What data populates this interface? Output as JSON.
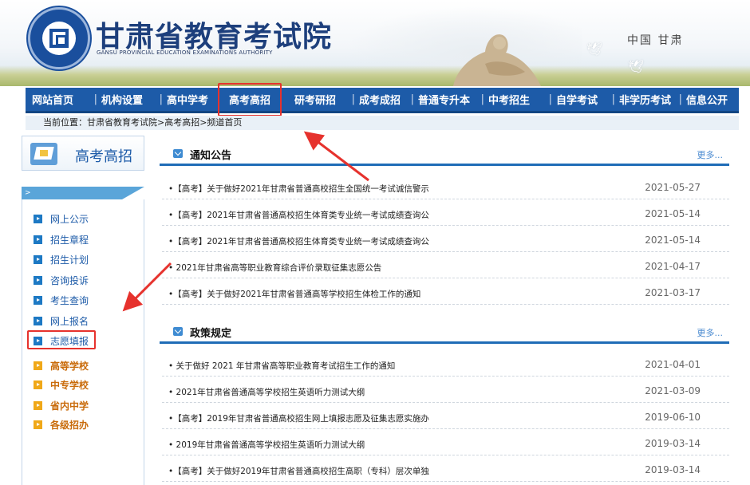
{
  "header": {
    "title": "甘肃省教育考试院",
    "subtitle": "GANSU PROVINCIAL EDUCATION EXAMINATIONS AUTHORITY",
    "region": "中国 甘肃"
  },
  "nav": {
    "items": [
      "网站首页",
      "机构设置",
      "高中学考",
      "高考高招",
      "研考研招",
      "成考成招",
      "普通专升本",
      "中考招生",
      "自学考试",
      "非学历考试",
      "信息公开"
    ]
  },
  "breadcrumb": "当前位置：甘肃省教育考试院>高考高招>频道首页",
  "sidebar": {
    "title": "高考高招",
    "bar_marker": ">",
    "items": [
      "网上公示",
      "招生章程",
      "招生计划",
      "咨询投诉",
      "考生查询",
      "网上报名",
      "志愿填报"
    ],
    "links": [
      "高等学校",
      "中专学校",
      "省内中学",
      "各级招办"
    ]
  },
  "sections": {
    "notices": {
      "title": "通知公告",
      "more": "更多...",
      "items": [
        {
          "title": "•【高考】关于做好2021年甘肃省普通高校招生全国统一考试诚信警示",
          "date": "2021-05-27"
        },
        {
          "title": "•【高考】2021年甘肃省普通高校招生体育类专业统一考试成绩查询公",
          "date": "2021-05-14"
        },
        {
          "title": "•【高考】2021年甘肃省普通高校招生体育类专业统一考试成绩查询公",
          "date": "2021-05-14"
        },
        {
          "title": "• 2021年甘肃省高等职业教育综合评价录取征集志愿公告",
          "date": "2021-04-17"
        },
        {
          "title": "•【高考】关于做好2021年甘肃省普通高等学校招生体检工作的通知",
          "date": "2021-03-17"
        }
      ]
    },
    "policy": {
      "title": "政策规定",
      "more": "更多...",
      "items": [
        {
          "title": "• 关于做好  2021  年甘肃省高等职业教育考试招生工作的通知",
          "date": "2021-04-01"
        },
        {
          "title": "• 2021年甘肃省普通高等学校招生英语听力测试大纲",
          "date": "2021-03-09"
        },
        {
          "title": "•【高考】2019年甘肃省普通高校招生网上填报志愿及征集志愿实施办",
          "date": "2019-06-10"
        },
        {
          "title": "• 2019年甘肃省普通高等学校招生英语听力测试大纲",
          "date": "2019-03-14"
        },
        {
          "title": "•【高考】关于做好2019年甘肃省普通高校招生高职（专科）层次单独",
          "date": "2019-03-14"
        }
      ]
    }
  },
  "colors": {
    "nav": "#1d5ba8",
    "annotation": "#e6322d",
    "accent": "#1f6cb7"
  }
}
